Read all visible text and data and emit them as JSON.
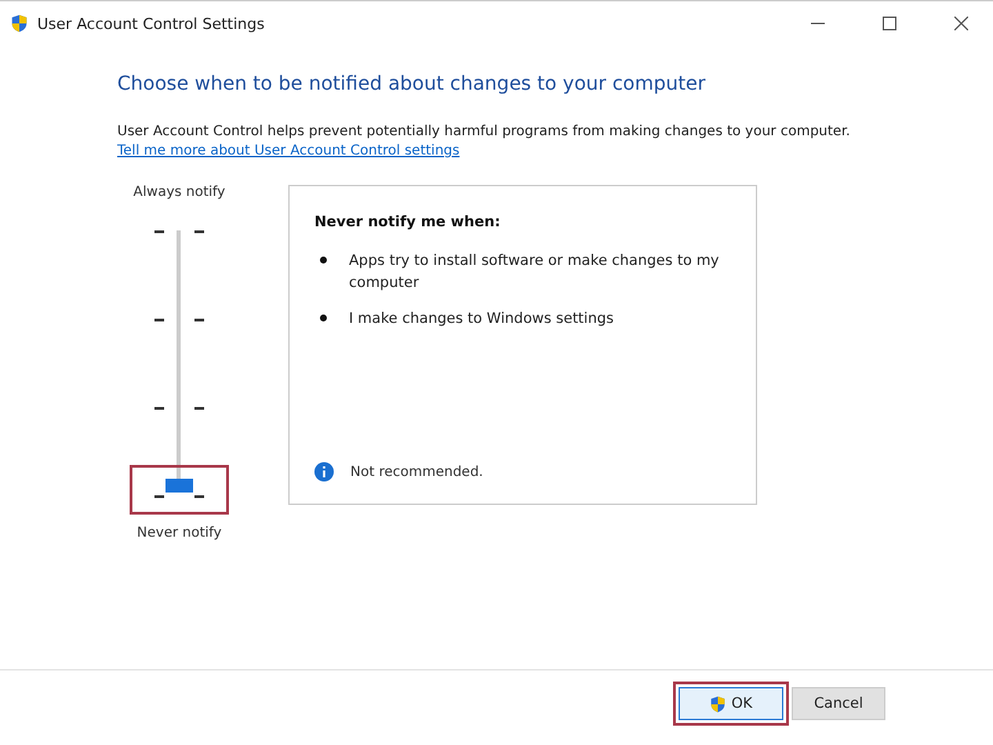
{
  "window": {
    "title": "User Account Control Settings"
  },
  "heading": "Choose when to be notified about changes to your computer",
  "description": "User Account Control helps prevent potentially harmful programs from making changes to your computer.",
  "link": "Tell me more about User Account Control settings",
  "slider": {
    "top_label": "Always notify",
    "bottom_label": "Never notify",
    "level": 0,
    "highlighted": true
  },
  "panel": {
    "title": "Never notify me when:",
    "bullets": [
      "Apps try to install software or make changes to my computer",
      "I make changes to Windows settings"
    ],
    "note": "Not recommended."
  },
  "buttons": [
    {
      "label": "OK",
      "kind": "shield",
      "highlighted": true
    },
    {
      "label": "Cancel",
      "kind": "plain",
      "highlighted": false
    }
  ]
}
